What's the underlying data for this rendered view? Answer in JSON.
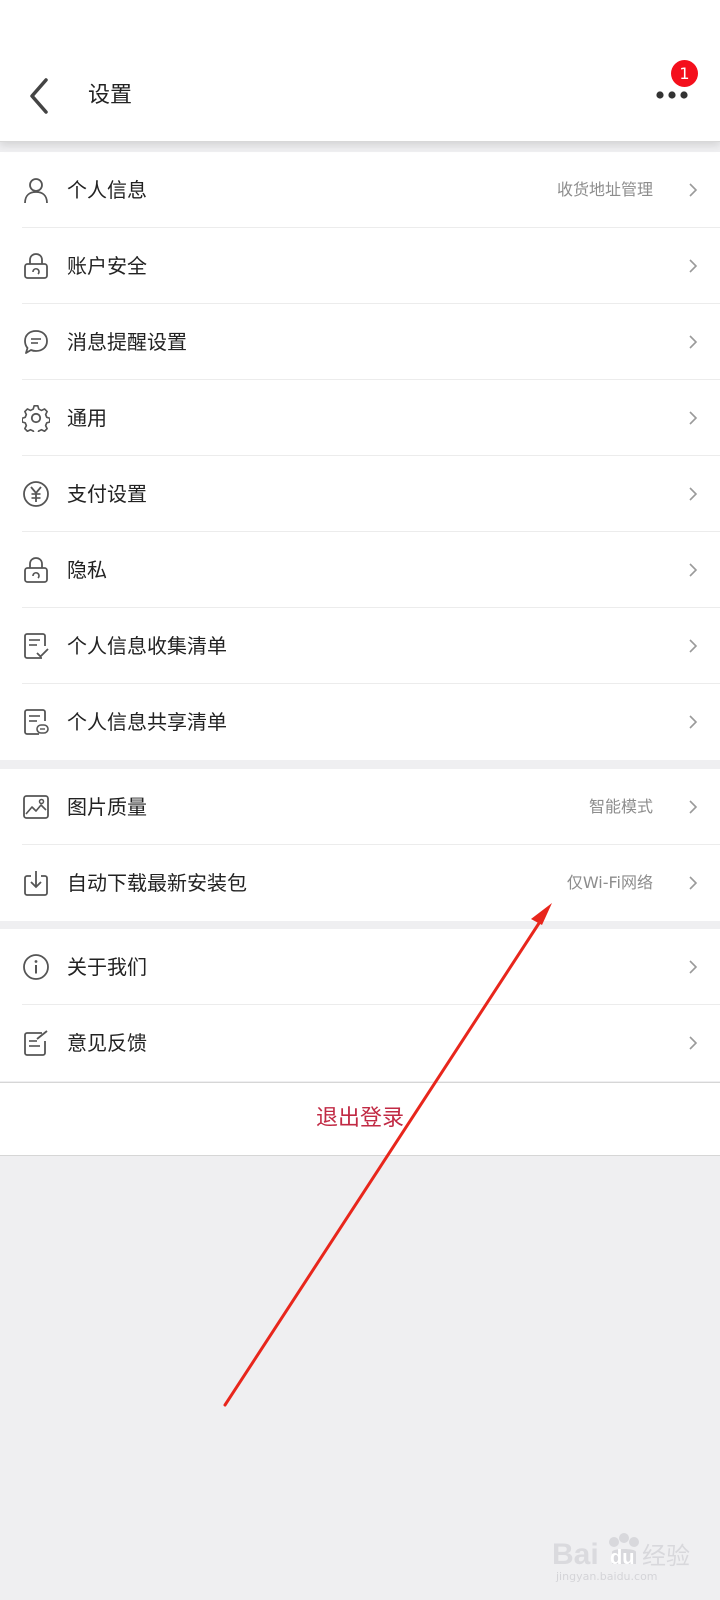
{
  "header": {
    "back_icon": "chevron-left-icon",
    "title": "设置",
    "more_icon": "more-horizontal-icon",
    "notification_count": "1"
  },
  "groups": [
    {
      "items": [
        {
          "icon": "user-icon",
          "label": "个人信息",
          "value": "收货地址管理"
        },
        {
          "icon": "lock-icon",
          "label": "账户安全",
          "value": ""
        },
        {
          "icon": "chat-bubble-icon",
          "label": "消息提醒设置",
          "value": ""
        },
        {
          "icon": "gear-icon",
          "label": "通用",
          "value": ""
        },
        {
          "icon": "yen-circle-icon",
          "label": "支付设置",
          "value": ""
        },
        {
          "icon": "lock-icon",
          "label": "隐私",
          "value": ""
        },
        {
          "icon": "checklist-icon",
          "label": "个人信息收集清单",
          "value": ""
        },
        {
          "icon": "share-list-icon",
          "label": "个人信息共享清单",
          "value": ""
        }
      ]
    },
    {
      "items": [
        {
          "icon": "image-icon",
          "label": "图片质量",
          "value": "智能模式"
        },
        {
          "icon": "download-icon",
          "label": "自动下载最新安装包",
          "value": "仅Wi-Fi网络"
        }
      ]
    },
    {
      "items": [
        {
          "icon": "info-circle-icon",
          "label": "关于我们",
          "value": ""
        },
        {
          "icon": "edit-note-icon",
          "label": "意见反馈",
          "value": ""
        }
      ]
    }
  ],
  "logout_label": "退出登录",
  "annotation": {
    "color": "#e8261c"
  },
  "watermark": {
    "brand": "Bai du 经验",
    "url": "jingyan.baidu.com"
  }
}
